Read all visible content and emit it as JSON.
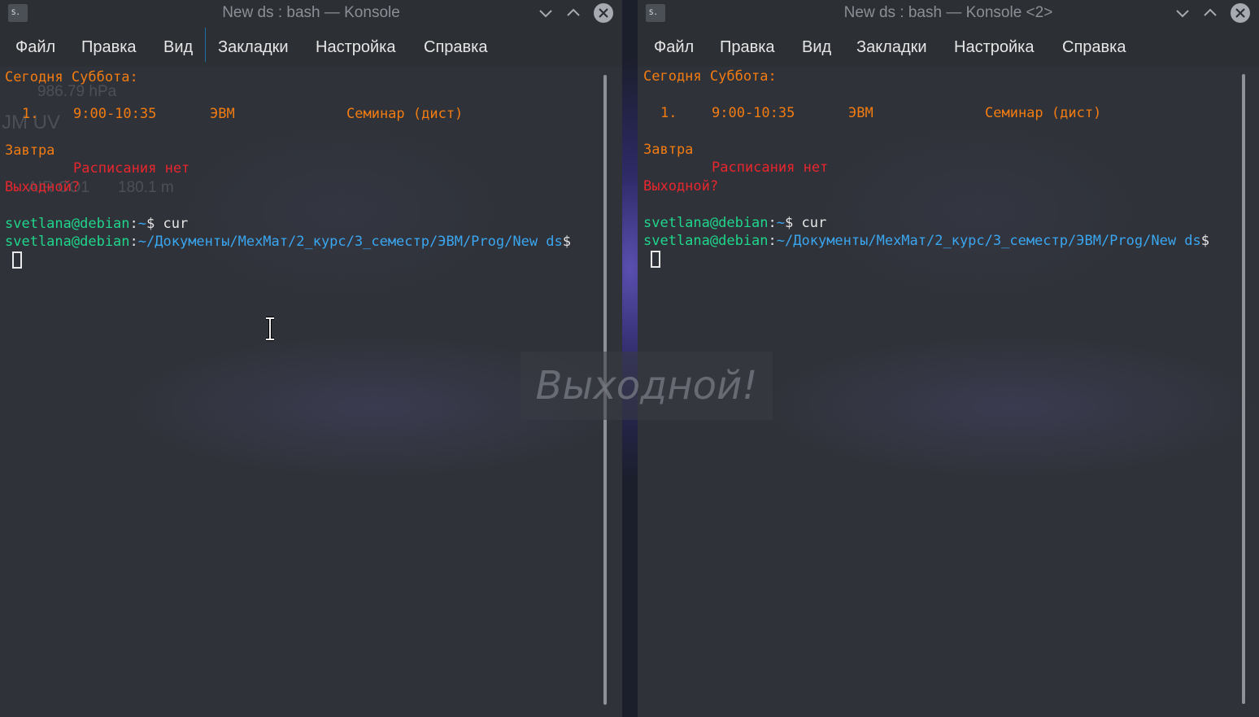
{
  "windows": [
    {
      "icon_label": "S.",
      "title": "New ds : bash — Konsole",
      "menu": [
        "Файл",
        "Правка",
        "Вид",
        "Закладки",
        "Настройка",
        "Справка"
      ],
      "terminal": {
        "today_header": "Сегодня Суббота:",
        "row_num": "1.",
        "row_time": "9:00-10:35",
        "row_subject": "ЭВМ",
        "row_type": "Семинар (дист)",
        "tomorrow_header": "Завтра",
        "no_schedule": "Расписания нет",
        "weekend_question": "Выходной?",
        "prompt_user": "svetlana@debian",
        "prompt_colon": ":",
        "prompt_home": "~",
        "prompt_dollar": "$",
        "command": "cur",
        "prompt_path": "~/Документы/МехМат/2_курс/3_семестр/ЭВМ/Prog/New ds"
      },
      "widget_ghost": {
        "pressure": "986.79 hPa",
        "uv": "JM UV",
        "co": "AIR CO1",
        "elevation": "180.1 m"
      }
    },
    {
      "icon_label": "S.",
      "title": "New ds : bash — Konsole <2>",
      "menu": [
        "Файл",
        "Правка",
        "Вид",
        "Закладки",
        "Настройка",
        "Справка"
      ],
      "terminal": {
        "today_header": "Сегодня Суббота:",
        "row_num": "1.",
        "row_time": "9:00-10:35",
        "row_subject": "ЭВМ",
        "row_type": "Семинар (дист)",
        "tomorrow_header": "Завтра",
        "no_schedule": "Расписания нет",
        "weekend_question": "Выходной?",
        "prompt_user": "svetlana@debian",
        "prompt_colon": ":",
        "prompt_home": "~",
        "prompt_dollar": "$",
        "command": "cur",
        "prompt_path": "~/Документы/МехМат/2_курс/3_семестр/ЭВМ/Prog/New ds"
      }
    }
  ],
  "osd_notification": "Выходной!",
  "icons": {
    "minimize": "chevron-down-icon",
    "maximize": "chevron-up-icon",
    "close": "close-icon",
    "text_cursor": "ibeam-cursor-icon"
  },
  "colors": {
    "schedule_orange": "#f27c12",
    "alert_red": "#e8262e",
    "prompt_green": "#1fd68c",
    "path_blue": "#3aa6f0",
    "window_bg": "#2f3238"
  }
}
